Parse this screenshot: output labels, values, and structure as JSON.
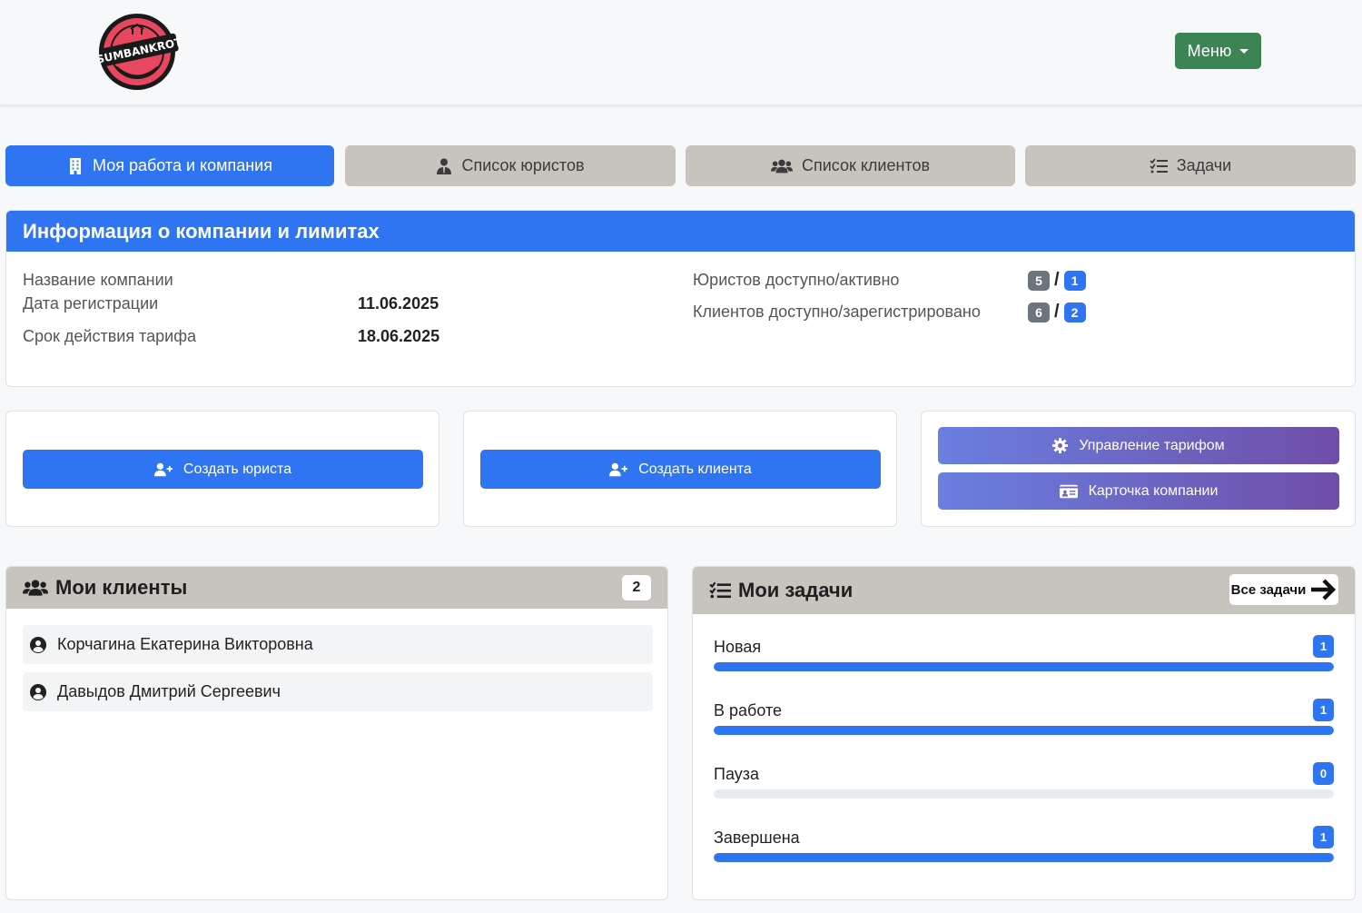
{
  "header": {
    "logo_text": "SUMBANKROT",
    "menu_label": "Меню"
  },
  "tabs": [
    {
      "label": "Моя работа и компания",
      "icon": "building-icon",
      "active": true
    },
    {
      "label": "Список юристов",
      "icon": "user-tie-icon",
      "active": false
    },
    {
      "label": "Список клиентов",
      "icon": "users-icon",
      "active": false
    },
    {
      "label": "Задачи",
      "icon": "tasks-list-icon",
      "active": false
    }
  ],
  "company_info": {
    "title": "Информация о компании и лимитах",
    "name_label": "Название компании",
    "name_value": "",
    "reg_date_label": "Дата регистрации",
    "reg_date_value": "11.06.2025",
    "tariff_label": "Срок действия тарифа",
    "tariff_value": "18.06.2025",
    "lawyers_label": "Юристов доступно/активно",
    "lawyers_available": "5",
    "lawyers_active": "1",
    "clients_label": "Клиентов доступно/зарегистрировано",
    "clients_available": "6",
    "clients_registered": "2",
    "separator": "/"
  },
  "actions": {
    "create_lawyer": "Создать юриста",
    "create_client": "Создать клиента",
    "manage_tariff": "Управление тарифом",
    "company_card": "Карточка компании"
  },
  "my_clients": {
    "title": "Мои клиенты",
    "count": "2",
    "items": [
      {
        "name": "Корчагина Екатерина Викторовна"
      },
      {
        "name": "Давыдов Дмитрий Сергеевич"
      }
    ]
  },
  "my_tasks": {
    "title": "Мои задачи",
    "all_label": "Все задачи",
    "statuses": [
      {
        "label": "Новая",
        "count": "1",
        "progress": 1.0
      },
      {
        "label": "В работе",
        "count": "1",
        "progress": 1.0
      },
      {
        "label": "Пауза",
        "count": "0",
        "progress": 0.0
      },
      {
        "label": "Завершена",
        "count": "1",
        "progress": 1.0
      }
    ]
  },
  "colors": {
    "primary": "#2f74f0",
    "menu_green": "#3d8455",
    "tab_inactive": "#c6c4bd",
    "gradient_start": "#6a7fe0",
    "gradient_end": "#6e4ea8",
    "badge_grey": "#6c757d"
  }
}
